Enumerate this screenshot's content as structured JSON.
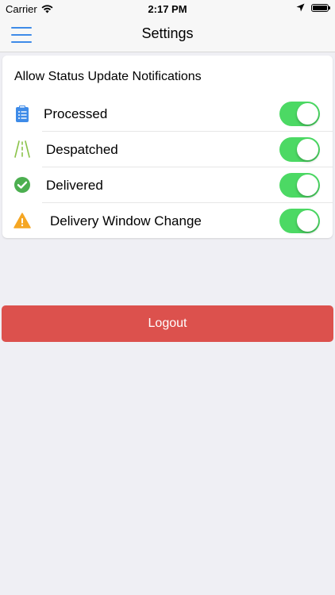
{
  "status_bar": {
    "carrier": "Carrier",
    "time": "2:17 PM"
  },
  "nav": {
    "title": "Settings",
    "menu_icon": "hamburger-menu-icon",
    "accent_color": "#3e8be8"
  },
  "notifications": {
    "title": "Allow Status Update Notifications",
    "items": [
      {
        "label": "Processed",
        "icon": "clipboard-list-icon",
        "icon_color": "#3e8be8",
        "enabled": true
      },
      {
        "label": "Despatched",
        "icon": "road-icon",
        "icon_color": "#8bc34a",
        "enabled": true
      },
      {
        "label": "Delivered",
        "icon": "check-circle-icon",
        "icon_color": "#4caf50",
        "enabled": true
      },
      {
        "label": "Delivery Window Change",
        "icon": "warning-triangle-icon",
        "icon_color": "#f5a623",
        "enabled": true
      }
    ],
    "toggle_on_color": "#4cd964"
  },
  "logout": {
    "label": "Logout",
    "color": "#dc514d"
  }
}
